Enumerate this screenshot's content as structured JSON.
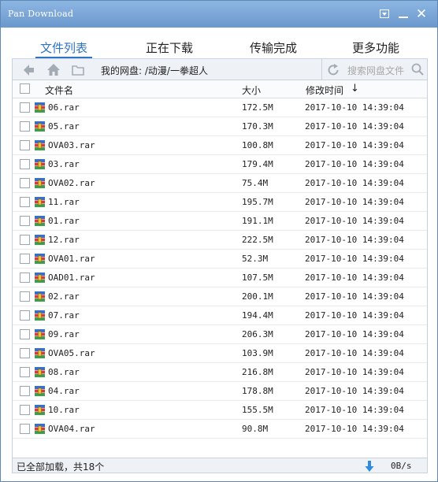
{
  "window": {
    "title": "Pan Download"
  },
  "tabs": [
    {
      "label": "文件列表",
      "active": true
    },
    {
      "label": "正在下载",
      "active": false
    },
    {
      "label": "传输完成",
      "active": false
    },
    {
      "label": "更多功能",
      "active": false
    }
  ],
  "toolbar": {
    "path": "我的网盘: /动漫/一拳超人",
    "search_placeholder": "搜索网盘文件"
  },
  "columns": {
    "name": "文件名",
    "size": "大小",
    "modified": "修改时间",
    "sort_arrow": "↓"
  },
  "files": [
    {
      "name": "06.rar",
      "size": "172.5M",
      "modified": "2017-10-10 14:39:04"
    },
    {
      "name": "05.rar",
      "size": "170.3M",
      "modified": "2017-10-10 14:39:04"
    },
    {
      "name": "OVA03.rar",
      "size": "100.8M",
      "modified": "2017-10-10 14:39:04"
    },
    {
      "name": "03.rar",
      "size": "179.4M",
      "modified": "2017-10-10 14:39:04"
    },
    {
      "name": "OVA02.rar",
      "size": "75.4M",
      "modified": "2017-10-10 14:39:04"
    },
    {
      "name": "11.rar",
      "size": "195.7M",
      "modified": "2017-10-10 14:39:04"
    },
    {
      "name": "01.rar",
      "size": "191.1M",
      "modified": "2017-10-10 14:39:04"
    },
    {
      "name": "12.rar",
      "size": "222.5M",
      "modified": "2017-10-10 14:39:04"
    },
    {
      "name": "OVA01.rar",
      "size": "52.3M",
      "modified": "2017-10-10 14:39:04"
    },
    {
      "name": "OAD01.rar",
      "size": "107.5M",
      "modified": "2017-10-10 14:39:04"
    },
    {
      "name": "02.rar",
      "size": "200.1M",
      "modified": "2017-10-10 14:39:04"
    },
    {
      "name": "07.rar",
      "size": "194.4M",
      "modified": "2017-10-10 14:39:04"
    },
    {
      "name": "09.rar",
      "size": "206.3M",
      "modified": "2017-10-10 14:39:04"
    },
    {
      "name": "OVA05.rar",
      "size": "103.9M",
      "modified": "2017-10-10 14:39:04"
    },
    {
      "name": "08.rar",
      "size": "216.8M",
      "modified": "2017-10-10 14:39:04"
    },
    {
      "name": "04.rar",
      "size": "178.8M",
      "modified": "2017-10-10 14:39:04"
    },
    {
      "name": "10.rar",
      "size": "155.5M",
      "modified": "2017-10-10 14:39:04"
    },
    {
      "name": "OVA04.rar",
      "size": "90.8M",
      "modified": "2017-10-10 14:39:04"
    }
  ],
  "status": {
    "text": "已全部加载，共18个",
    "speed": "0B/s"
  },
  "icons": {
    "back": "back-arrow-icon",
    "home": "home-icon",
    "folder": "folder-icon",
    "refresh": "refresh-icon",
    "search": "search-icon",
    "file": "rar-file-icon",
    "download": "download-arrow-icon",
    "menu": "menu-dropdown-icon",
    "minimize": "minimize-icon",
    "close": "close-icon"
  },
  "colors": {
    "accent": "#2f73c4",
    "titlebar": "#7aa6d8"
  }
}
